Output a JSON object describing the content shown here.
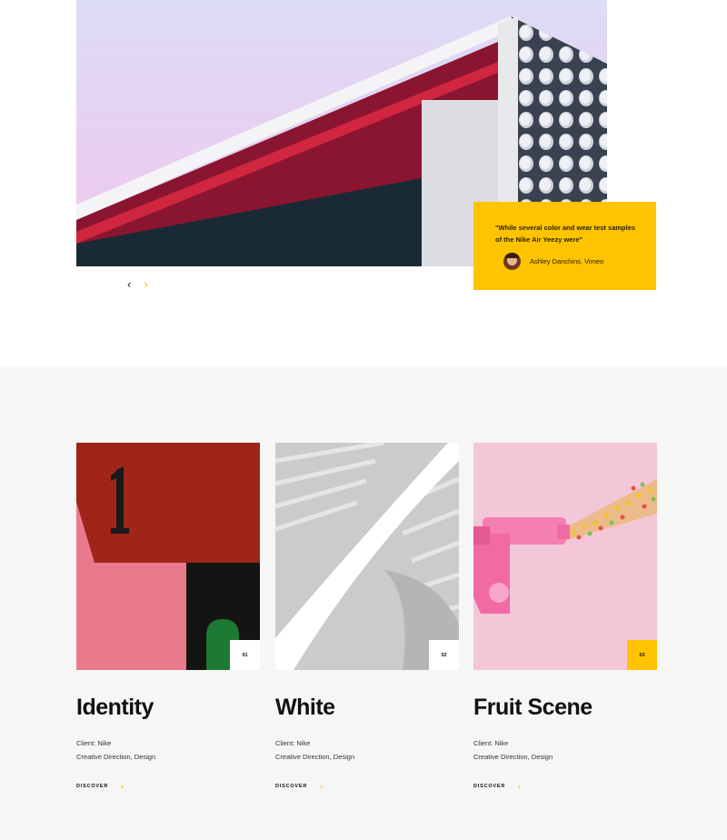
{
  "hero": {
    "quote": "\"While several color and wear test samples of the Nike Air Yeezy were\"",
    "author": "Ashley Danchins, Vimeo",
    "nav": {
      "prev": "‹",
      "next": "›"
    }
  },
  "projects": [
    {
      "number": "01",
      "title": "Identity",
      "client": "Client: Nike",
      "role": "Creative Direction, Design",
      "discover": "DISCOVER",
      "arrow": "›"
    },
    {
      "number": "02",
      "title": "White",
      "client": "Client: Nike",
      "role": "Creative Direction, Design",
      "discover": "DISCOVER",
      "arrow": "›"
    },
    {
      "number": "03",
      "title": "Fruit Scene",
      "client": "Client: Nike",
      "role": "Creative Direction, Design",
      "discover": "DISCOVER",
      "arrow": "›"
    }
  ],
  "colors": {
    "accent": "#ffc300",
    "section_bg": "#f6f6f6"
  },
  "images": {
    "hero": "architecture-photo",
    "project_1": "abstract-number-photo",
    "project_2": "spiral-staircase-photo",
    "project_3": "pink-candy-gun-photo"
  }
}
